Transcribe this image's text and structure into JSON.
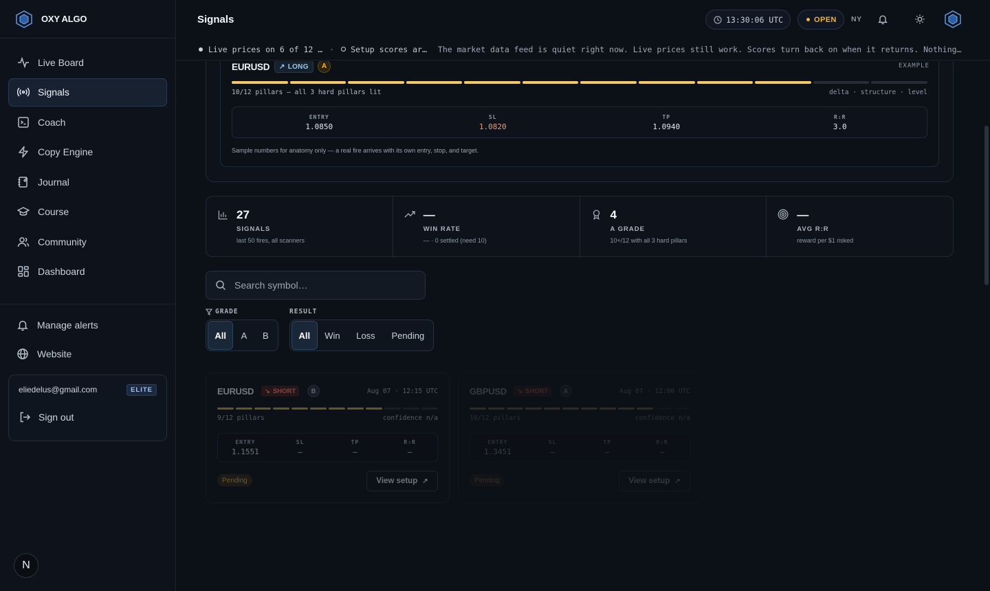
{
  "brand": {
    "name": "OXY ALGO"
  },
  "sidebar": {
    "items": [
      {
        "label": "Live Board",
        "icon": "pulse-icon"
      },
      {
        "label": "Signals",
        "icon": "broadcast-icon",
        "active": true
      },
      {
        "label": "Coach",
        "icon": "terminal-icon"
      },
      {
        "label": "Copy Engine",
        "icon": "lightning-icon"
      },
      {
        "label": "Journal",
        "icon": "notebook-icon"
      },
      {
        "label": "Course",
        "icon": "graduation-cap-icon"
      },
      {
        "label": "Community",
        "icon": "users-icon"
      },
      {
        "label": "Dashboard",
        "icon": "grid-icon"
      }
    ],
    "bottom": [
      {
        "label": "Manage alerts",
        "icon": "bell-icon"
      },
      {
        "label": "Website",
        "icon": "globe-icon"
      }
    ],
    "user": {
      "email": "eliedelus@gmail.com",
      "tier": "ELITE",
      "signout": "Sign out"
    },
    "footer_badge": "N"
  },
  "header": {
    "title": "Signals",
    "clock": "13:30:06 UTC",
    "session_status": "OPEN",
    "session_city": "NY"
  },
  "ticker": {
    "live_prices": "Live prices on 6 of 12 …",
    "setup_scores": "Setup scores ar…",
    "message": "The market data feed is quiet right now. Live prices still work. Scores turn back on when it returns. Nothing to do…"
  },
  "example": {
    "symbol": "EURUSD",
    "direction": "LONG",
    "grade": "A",
    "tag": "EXAMPLE",
    "pillars_on": 10,
    "pillars_total": 12,
    "pillars_text": "10/12 pillars — all 3 hard pillars lit",
    "tags": "delta · structure · level",
    "levels": {
      "entry_label": "ENTRY",
      "entry": "1.0850",
      "sl_label": "SL",
      "sl": "1.0820",
      "tp_label": "TP",
      "tp": "1.0940",
      "rr_label": "R:R",
      "rr": "3.0"
    },
    "note": "Sample numbers for anatomy only — a real fire arrives with its own entry, stop, and target."
  },
  "stats": [
    {
      "value": "27",
      "label": "SIGNALS",
      "sub": "last 50 fires, all scanners",
      "icon": "bar-chart-icon"
    },
    {
      "value": "—",
      "label": "WIN RATE",
      "sub": "— · 0 settled (need 10)",
      "icon": "trending-up-icon"
    },
    {
      "value": "4",
      "label": "A GRADE",
      "sub": "10+/12 with all 3 hard pillars",
      "icon": "award-icon"
    },
    {
      "value": "—",
      "label": "AVG R:R",
      "sub": "reward per $1 risked",
      "icon": "target-icon"
    }
  ],
  "search": {
    "placeholder": "Search symbol…"
  },
  "filters": {
    "grade_label": "GRADE",
    "grade_options": [
      "All",
      "A",
      "B"
    ],
    "grade_selected": "All",
    "result_label": "RESULT",
    "result_options": [
      "All",
      "Win",
      "Loss",
      "Pending"
    ],
    "result_selected": "All"
  },
  "signals": [
    {
      "symbol": "EURUSD",
      "direction": "SHORT",
      "grade": "B",
      "time": "Aug 07 · 12:15 UTC",
      "pillars_on": 9,
      "pillars_total": 12,
      "pillars_text": "9/12 pillars",
      "confidence": "confidence n/a",
      "entry_label": "ENTRY",
      "entry": "1.1551",
      "sl_label": "SL",
      "sl": "—",
      "tp_label": "TP",
      "tp": "—",
      "rr_label": "R:R",
      "rr": "—",
      "status": "Pending",
      "action": "View setup"
    },
    {
      "symbol": "GBPUSD",
      "direction": "SHORT",
      "grade": "A",
      "time": "Aug 07 · 12:00 UTC",
      "pillars_on": 10,
      "pillars_total": 12,
      "pillars_text": "10/12 pillars",
      "confidence": "confidence n/a",
      "entry_label": "ENTRY",
      "entry": "1.3451",
      "sl_label": "SL",
      "sl": "—",
      "tp_label": "TP",
      "tp": "—",
      "rr_label": "R:R",
      "rr": "—",
      "status": "Pending",
      "action": "View setup"
    }
  ],
  "colors": {
    "background": "#0c1017",
    "accent_gold": "#f0b441",
    "pillar_lit": "#f2c869",
    "short_red": "#e0706d",
    "active_nav": "#172130"
  }
}
